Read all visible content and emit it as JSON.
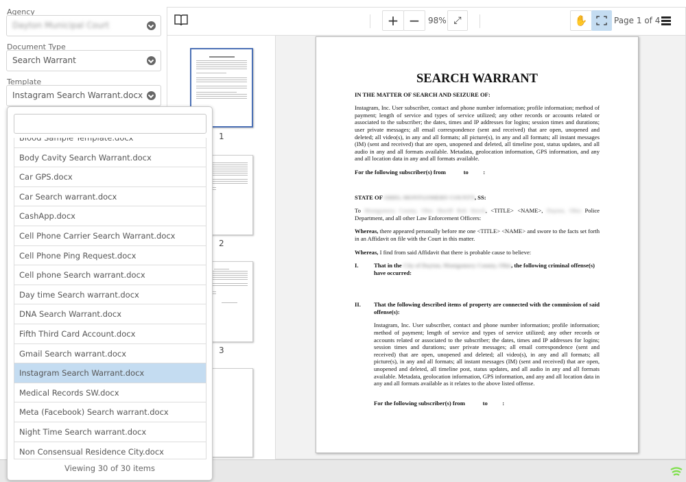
{
  "form": {
    "agency": {
      "label": "Agency",
      "value": "Dayton Municipal Court"
    },
    "document_type": {
      "label": "Document Type",
      "value": "Search Warrant"
    },
    "template": {
      "label": "Template",
      "value": "Instagram Search Warrant.docx"
    }
  },
  "dropdown": {
    "search_value": "",
    "items": [
      "Blood Sample Template.docx",
      "Body Cavity Search Warrant.docx",
      "Car GPS.docx",
      "Car Search warrant.docx",
      "CashApp.docx",
      "Cell Phone Carrier Search Warrant.docx",
      "Cell Phone Ping Request.docx",
      "Cell phone Search warrant.docx",
      "Day time Search warrant.docx",
      "DNA Search Warrant.docx",
      "Fifth Third Card Account.docx",
      "Gmail Search warrant.docx",
      "Instagram Search Warrant.docx",
      "Medical Records SW.docx",
      "Meta (Facebook) Search warrant.docx",
      "Night Time Search warrant.docx",
      "Non Consensual Residence City.docx"
    ],
    "selected": "Instagram Search Warrant.docx",
    "footer": "Viewing 30 of 30 items"
  },
  "toolbar": {
    "zoom_in": "+",
    "zoom_out": "−",
    "zoom_level": "98%",
    "page_indicator": "Page 1 of 4"
  },
  "thumbnails": [
    "1",
    "2",
    "3"
  ],
  "document": {
    "title": "SEARCH WARRANT",
    "matter": "IN THE MATTER OF SEARCH AND SEIZURE OF:",
    "para1": "Instagram, Inc.  User subscriber, contact and phone number information; profile information; method of payment;  length of service and types of service utilized; any other records or accounts related or associated to the subscriber; the dates, times and IP addresses for logins; session times and durations; user private messages; all email correspondence (sent and received) that are open, unopened and deleted; all video(s), in any and all formats; all picture(s), in any and all formats; all instant messages (IM) (sent and received) that are open, unopened and deleted, all timeline post, status updates, and all audio in any and all formats available. Metadata, geolocation information, GPS information, and any and all location data in any and all formats available.",
    "subscriber_line": "For the following subscriber(s) from            to          :",
    "state_prefix": "STATE OF ",
    "state_blur": "OHIO, MONTGOMERY COUNTY",
    "state_suffix": ", SS:",
    "to_prefix": "To ",
    "to_blur1": "Montgomery County, Ohio Sheriff Rob Streck",
    "to_mid": ", <TITLE> <NAME>, ",
    "to_blur2": "Dayton, Ohio",
    "to_suffix": " Police Department, and all other Law Enforcement Officers:",
    "whereas1_bold": "Whereas,",
    "whereas1": " there appeared personally before me one <TITLE> <NAME> and swore to the facts set forth in an Affidavit on file with the Court in this matter.",
    "whereas2_bold": "Whereas,",
    "whereas2": " I find from said Affidavit that there is probable cause to believe:",
    "sec1_num": "I.",
    "sec1_prefix": "That in the ",
    "sec1_blur": "City of Dayton, Montgomery County, Ohio",
    "sec1_suffix": ", the following criminal offense(s) have occurred:",
    "sec2_num": "II.",
    "sec2": "That the following described items of property are connected with the commission of said offense(s):",
    "para2": "Instagram, Inc.  User subscriber, contact and phone number information; profile information; method of payment; length of service and types of service utilized; any other records or accounts related or associated to the subscriber; the dates, times and IP addresses for logins; session times and durations; user private messages; all email correspondence (sent and received) that are open, unopened and deleted;  all video(s), in any and all formats;  all picture(s), in any and all formats; all instant messages (IM) (sent and received) that are open, unopened and deleted, all timeline post, status updates, and all audio in any and all formats available.  Metadata, geolocation information, GPS information, and any and all location data in any and all formats available as it relates to the above listed offense.",
    "subscriber_line2": "For the following subscriber(s) from            to          :"
  },
  "colors": {
    "selected_row": "#c4dcf1",
    "active_tool": "#c4dcf1",
    "thumb_active_border": "#4a6fb5",
    "signal": "#7ee04a"
  }
}
